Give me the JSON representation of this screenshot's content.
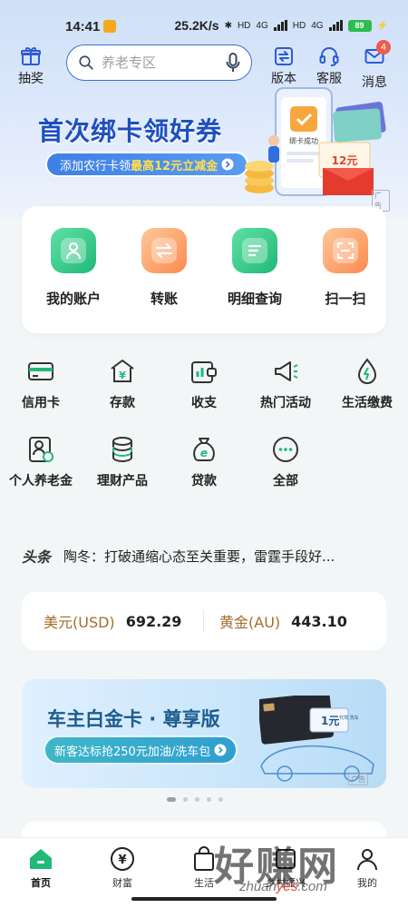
{
  "status_bar": {
    "time": "14:41",
    "speed": "25.2K/s",
    "net1": "4G",
    "net2": "4G",
    "hd1": "HD",
    "hd2": "HD",
    "battery": "89"
  },
  "header": {
    "gift_label": "抽奖",
    "search_placeholder": "养老专区",
    "version_label": "版本",
    "service_label": "客服",
    "message_label": "消息",
    "message_badge": "4"
  },
  "banner": {
    "title": "首次绑卡领好券",
    "subtitle_pre": "添加农行卡领",
    "subtitle_highlight": "最高12元立减金",
    "phone_text": "绑卡成功",
    "coupon_text": "12元",
    "ad_tag": "广告"
  },
  "quick_actions": [
    {
      "label": "我的账户",
      "color": "green",
      "icon": "account-icon"
    },
    {
      "label": "转账",
      "color": "orange",
      "icon": "transfer-icon"
    },
    {
      "label": "明细查询",
      "color": "green",
      "icon": "details-icon"
    },
    {
      "label": "扫一扫",
      "color": "orange",
      "icon": "scan-icon"
    }
  ],
  "services": [
    {
      "label": "信用卡",
      "icon": "credit-card-icon"
    },
    {
      "label": "存款",
      "icon": "deposit-icon"
    },
    {
      "label": "收支",
      "icon": "income-expense-icon"
    },
    {
      "label": "热门活动",
      "icon": "megaphone-icon"
    },
    {
      "label": "生活缴费",
      "icon": "utility-icon"
    },
    {
      "label": "个人养老金",
      "icon": "pension-icon"
    },
    {
      "label": "理财产品",
      "icon": "wealth-icon"
    },
    {
      "label": "贷款",
      "icon": "loan-icon"
    },
    {
      "label": "全部",
      "icon": "more-icon"
    }
  ],
  "news": {
    "tag": "头条",
    "text": "陶冬：打破通缩心态至关重要，雷霆手段好..."
  },
  "rates": [
    {
      "name": "美元(USD)",
      "value": "692.29"
    },
    {
      "name": "黄金(AU)",
      "value": "443.10"
    }
  ],
  "car_banner": {
    "title": "车主白金卡 · 尊享版",
    "subtitle": "新客达标抢250元加油/洗车包",
    "card_text": "1元",
    "card_sub": "代驾 洗车",
    "ad_tag": "广告"
  },
  "carousel": {
    "count": 5,
    "active": 0
  },
  "bottom_nav": [
    {
      "label": "首页",
      "active": true
    },
    {
      "label": "财富",
      "active": false
    },
    {
      "label": "生活",
      "active": false
    },
    {
      "label": "乡村振兴",
      "active": false
    },
    {
      "label": "我的",
      "active": false
    }
  ],
  "watermark": {
    "main": "好赚网",
    "url_pre": "zhuan",
    "url_mid": "yes",
    "url_post": ".com"
  },
  "colors": {
    "brand_green": "#21b978",
    "brand_orange": "#fb8a4e",
    "primary_blue": "#1d4fbf",
    "rate_gold": "#a66d2b",
    "badge_red": "#f25a4a"
  }
}
